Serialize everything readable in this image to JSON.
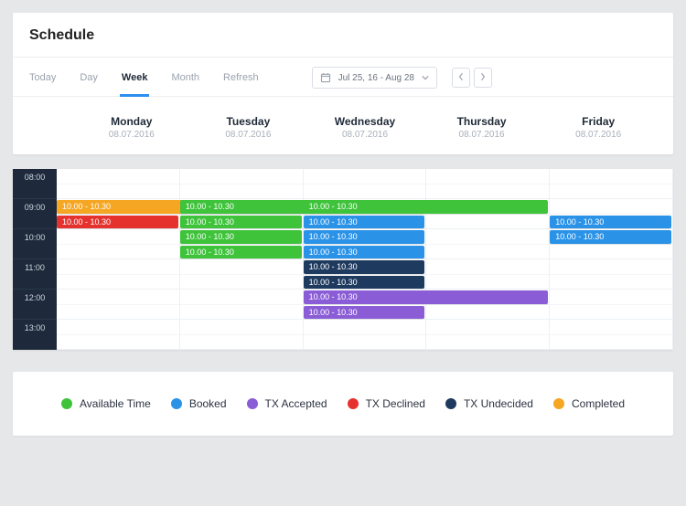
{
  "title": "Schedule",
  "tabs": [
    "Today",
    "Day",
    "Week",
    "Month",
    "Refresh"
  ],
  "active_tab_index": 2,
  "date_range": "Jul 25, 16 - Aug 28",
  "days": [
    {
      "name": "Monday",
      "date": "08.07.2016"
    },
    {
      "name": "Tuesday",
      "date": "08.07.2016"
    },
    {
      "name": "Wednesday",
      "date": "08.07.2016"
    },
    {
      "name": "Thursday",
      "date": "08.07.2016"
    },
    {
      "name": "Friday",
      "date": "08.07.2016"
    }
  ],
  "hours": [
    "08:00",
    "09:00",
    "10:00",
    "11:00",
    "12:00",
    "13:00"
  ],
  "colors": {
    "available": "#3ec33b",
    "booked": "#2a93e8",
    "tx_accepted": "#8a5cd6",
    "tx_declined": "#e6322e",
    "tx_undecided": "#1f3a5f",
    "completed": "#f5a623"
  },
  "events": [
    {
      "label": "10.00 - 10.30",
      "day": 0,
      "slot": 2,
      "span": 2,
      "color": "completed"
    },
    {
      "label": "10.00 - 10.30",
      "day": 0,
      "slot": 3,
      "span": 1,
      "color": "tx_declined"
    },
    {
      "label": "10.00 - 10.30",
      "day": 1,
      "slot": 2,
      "span": 2,
      "color": "available"
    },
    {
      "label": "10.00 - 10.30",
      "day": 1,
      "slot": 3,
      "span": 1,
      "color": "available"
    },
    {
      "label": "10.00 - 10.30",
      "day": 1,
      "slot": 4,
      "span": 1,
      "color": "available"
    },
    {
      "label": "10.00 - 10.30",
      "day": 1,
      "slot": 5,
      "span": 1,
      "color": "available"
    },
    {
      "label": "10.00 - 10.30",
      "day": 2,
      "slot": 2,
      "span": 2,
      "color": "available"
    },
    {
      "label": "10.00 - 10.30",
      "day": 2,
      "slot": 3,
      "span": 1,
      "color": "booked"
    },
    {
      "label": "10.00 - 10.30",
      "day": 2,
      "slot": 4,
      "span": 1,
      "color": "booked"
    },
    {
      "label": "10.00 - 10.30",
      "day": 2,
      "slot": 5,
      "span": 1,
      "color": "booked"
    },
    {
      "label": "10.00 - 10.30",
      "day": 2,
      "slot": 6,
      "span": 1,
      "color": "tx_undecided"
    },
    {
      "label": "10.00 - 10.30",
      "day": 2,
      "slot": 7,
      "span": 1,
      "color": "tx_undecided"
    },
    {
      "label": "10.00 - 10.30",
      "day": 2,
      "slot": 8,
      "span": 2,
      "color": "tx_accepted"
    },
    {
      "label": "10.00 - 10.30",
      "day": 2,
      "slot": 9,
      "span": 1,
      "color": "tx_accepted"
    },
    {
      "label": "10.00 - 10.30",
      "day": 4,
      "slot": 3,
      "span": 1,
      "color": "booked"
    },
    {
      "label": "10.00 - 10.30",
      "day": 4,
      "slot": 4,
      "span": 1,
      "color": "booked"
    }
  ],
  "legend": [
    {
      "label": "Available Time",
      "color": "available"
    },
    {
      "label": "Booked",
      "color": "booked"
    },
    {
      "label": "TX Accepted",
      "color": "tx_accepted"
    },
    {
      "label": "TX Declined",
      "color": "tx_declined"
    },
    {
      "label": "TX Undecided",
      "color": "tx_undecided"
    },
    {
      "label": "Completed",
      "color": "completed"
    }
  ]
}
